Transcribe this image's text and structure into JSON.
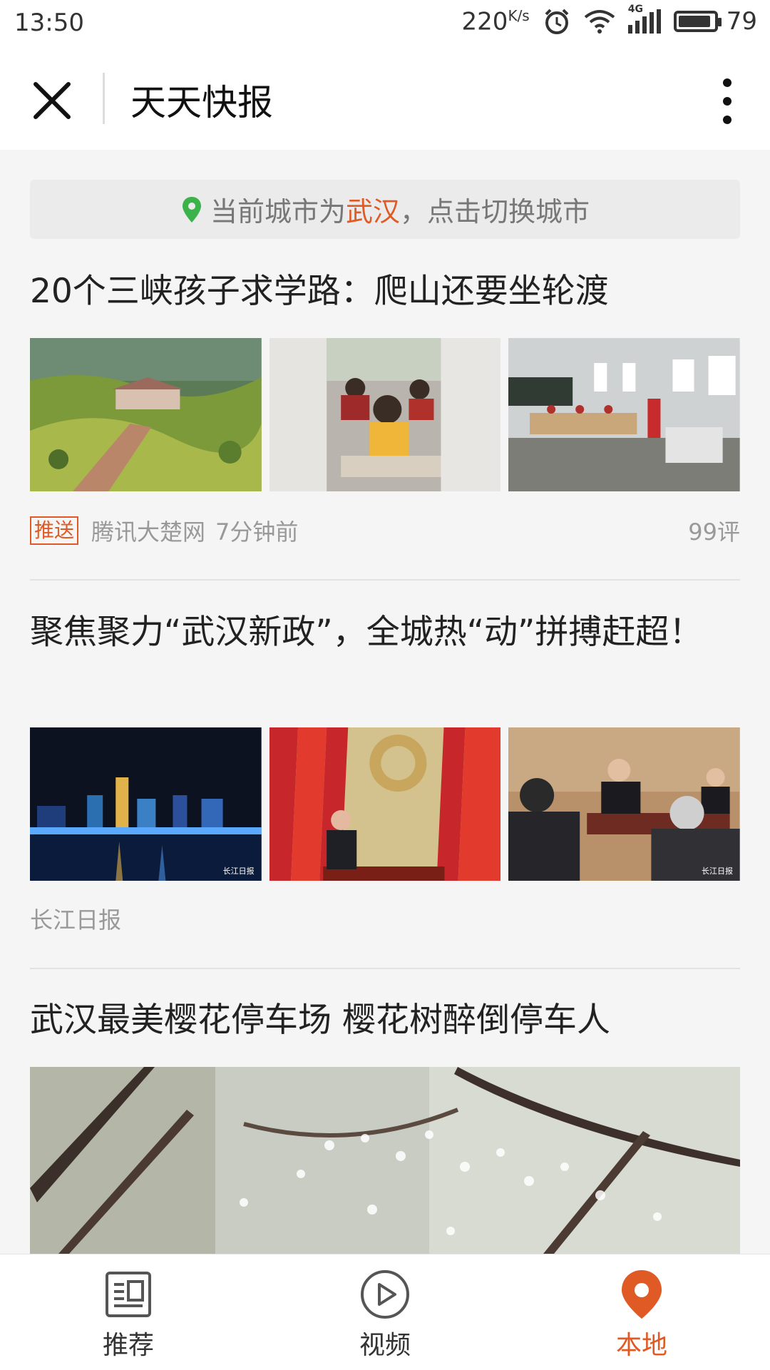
{
  "status_bar": {
    "time": "13:50",
    "net_speed": "220",
    "net_unit": "K/s",
    "signal": "4G",
    "battery": "79"
  },
  "header": {
    "title": "天天快报",
    "close_icon": "close-icon",
    "more_icon": "more-vertical-icon"
  },
  "city_banner": {
    "prefix": "当前城市为 ",
    "city": "武汉",
    "suffix": "，点击切换城市"
  },
  "articles": [
    {
      "title": "20个三峡孩子求学路：爬山还要坐轮渡",
      "tag": "推送",
      "source": "腾讯大楚网",
      "time": "7分钟前",
      "comments": "99评"
    },
    {
      "title": "聚焦聚力“武汉新政”，全城热“动”拼搏赶超！",
      "source": "长江日报",
      "watermark": "长江日报"
    },
    {
      "title": "武汉最美樱花停车场 樱花树醉倒停车人"
    }
  ],
  "tabs": [
    {
      "label": "推荐",
      "icon": "news-icon"
    },
    {
      "label": "视频",
      "icon": "play-icon"
    },
    {
      "label": "本地",
      "icon": "location-icon",
      "active": true
    }
  ],
  "colors": {
    "accent": "#e05a25",
    "pin_green": "#3cb34a"
  }
}
